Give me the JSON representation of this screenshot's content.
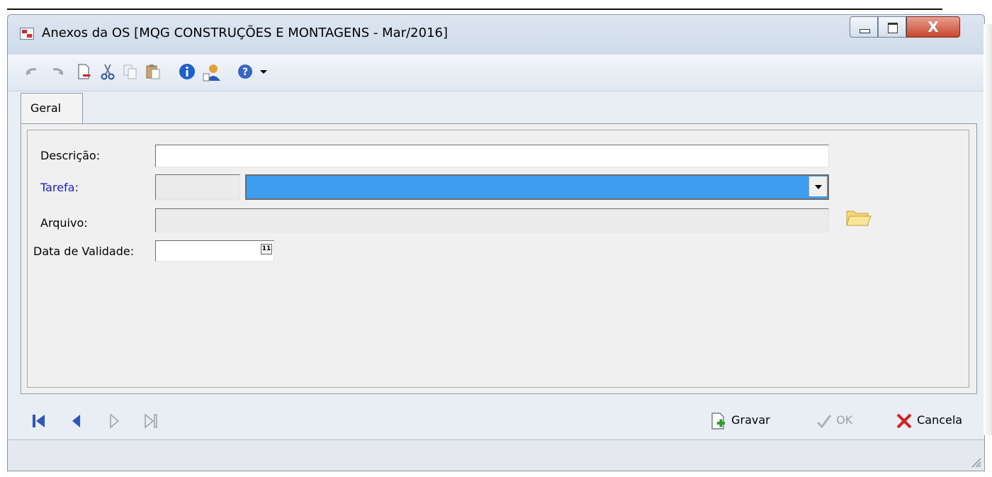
{
  "window": {
    "title": "Anexos da OS [MQG CONSTRUÇÕES E MONTAGENS - Mar/2016]",
    "close_glyph": "X"
  },
  "toolbar": {
    "icons": [
      "undo-icon",
      "redo-icon",
      "new-document-icon",
      "cut-icon",
      "copy-icon",
      "paste-icon",
      "info-icon",
      "user-icon",
      "help-icon",
      "dropdown-arrow-icon"
    ]
  },
  "tabs": [
    {
      "label": "Geral",
      "active": true
    }
  ],
  "form": {
    "descricao_label": "Descrição:",
    "descricao_value": "",
    "tarefa_label": "Tarefa:",
    "tarefa_code": "",
    "tarefa_selected": "",
    "arquivo_label": "Arquivo:",
    "arquivo_value": "",
    "validade_label": "Data de Validade:",
    "validade_value": "",
    "calendar_glyph": "11"
  },
  "actions": {
    "gravar": "Gravar",
    "ok": "OK",
    "cancela": "Cancela"
  },
  "colors": {
    "combo_selected": "#3f9df0",
    "link_label": "#1f1fd6",
    "nav_blue": "#2f56b8",
    "cancel_red": "#d82020"
  }
}
